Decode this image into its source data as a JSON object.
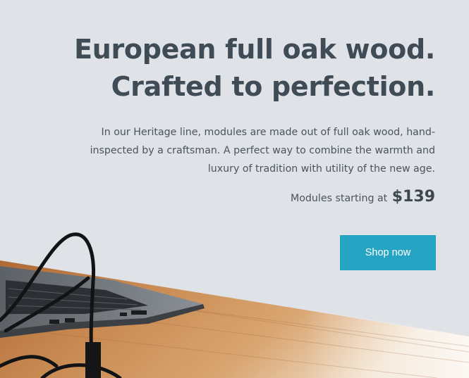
{
  "hero": {
    "headline_line1": "European full oak wood.",
    "headline_line2": "Crafted to perfection.",
    "description": "In our Heritage line, modules are made out of full oak wood, hand-inspected by a craftsman. A perfect way to combine the warmth and luxury of tradition with utility of the new age.",
    "price_prefix": "Modules starting at",
    "price": "$139",
    "cta_label": "Shop now"
  },
  "colors": {
    "background": "#dfe2e7",
    "heading": "#3f4b55",
    "body_text": "#4a545c",
    "cta": "#25a4c3",
    "cta_text": "#ffffff"
  }
}
